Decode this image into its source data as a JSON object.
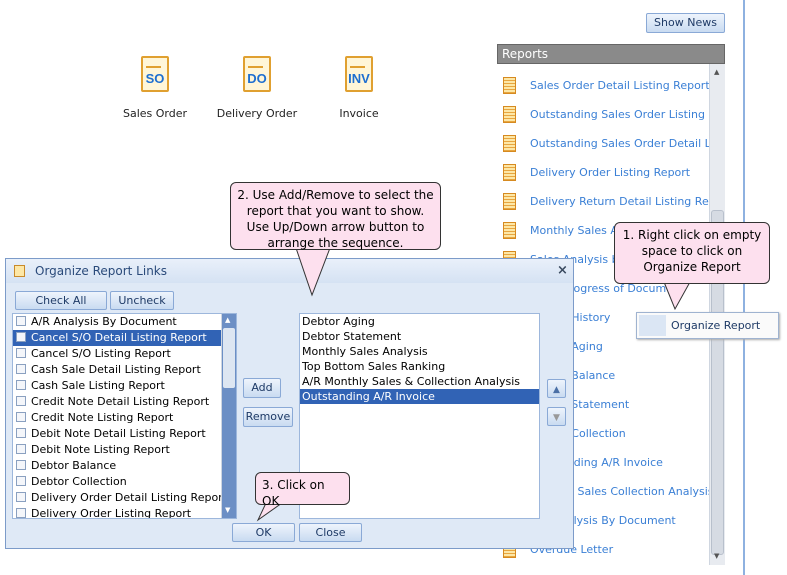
{
  "show_news": "Show News",
  "documents": [
    {
      "abbr": "SO",
      "label": "Sales Order"
    },
    {
      "abbr": "DO",
      "label": "Delivery Order"
    },
    {
      "abbr": "INV",
      "label": "Invoice"
    }
  ],
  "reports": {
    "title": "Reports",
    "items": [
      "Sales Order Detail Listing Report",
      "Outstanding Sales Order Listing Report",
      "Outstanding Sales Order Detail Listing Report",
      "Delivery Order Listing Report",
      "Delivery Return Detail Listing Report",
      "Monthly Sales Analysis",
      "Sales Analysis by Document",
      "Sales Progress of Document",
      "Debtor History",
      "Debtor Aging",
      "Debtor Balance",
      "Debtor Statement",
      "Debtor Collection",
      "Outstanding A/R Invoice",
      "Monthly Sales  Collection Analysis",
      "A/R Analysis By Document",
      "Overdue Letter"
    ]
  },
  "context_menu": {
    "item": "Organize Report"
  },
  "dialog": {
    "title": "Organize Report Links",
    "check_all": "Check All",
    "uncheck_all": "Uncheck All",
    "add": "Add",
    "remove": "Remove",
    "ok": "OK",
    "close": "Close",
    "available": [
      "A/R Analysis By Document",
      "Cancel S/O Detail Listing Report",
      "Cancel S/O Listing Report",
      "Cash Sale Detail Listing Report",
      "Cash Sale Listing Report",
      "Credit Note Detail Listing Report",
      "Credit Note Listing Report",
      "Debit Note Detail Listing Report",
      "Debit Note Listing Report",
      "Debtor Balance",
      "Debtor Collection",
      "Delivery Order Detail Listing Report",
      "Delivery Order Listing Report"
    ],
    "available_selected": 1,
    "selected": [
      "Debtor Aging",
      "Debtor Statement",
      "Monthly Sales Analysis",
      "Top Bottom Sales Ranking",
      "A/R Monthly Sales & Collection Analysis",
      "Outstanding A/R Invoice"
    ],
    "selected_selected": 5
  },
  "callouts": {
    "step1": "1. Right click on empty space to click on Organize Report",
    "step2": "2. Use Add/Remove to select the report that you want to show. Use Up/Down arrow button to arrange the sequence.",
    "step3": "3. Click on OK"
  }
}
